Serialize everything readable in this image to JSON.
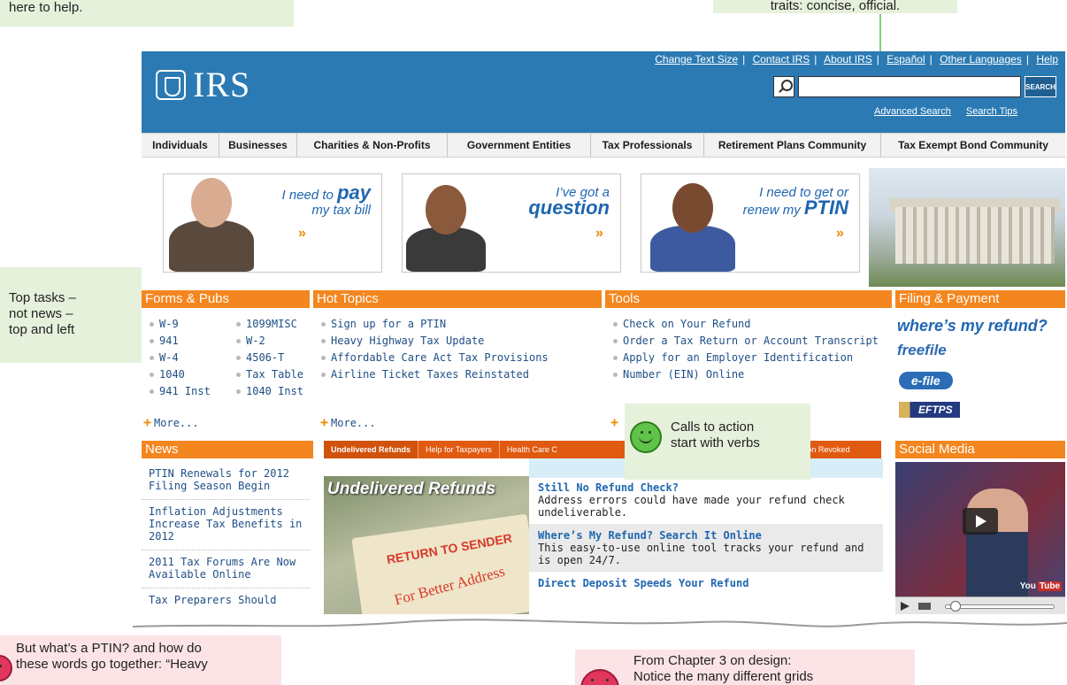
{
  "annotations": {
    "top_left": "here to help.",
    "top_right": "traits: concise, official.",
    "left": [
      "Top tasks –",
      "not news –",
      "top and left"
    ],
    "calls_to_action": [
      "Calls to action",
      "start with verbs"
    ],
    "bottom_left": [
      "But what’s a PTIN? and how do",
      "these words go together: “Heavy"
    ],
    "bottom_right": [
      "From Chapter 3 on design:",
      "Notice the many different grids"
    ]
  },
  "header": {
    "logo": "IRS",
    "top_links": [
      "Change Text Size",
      "Contact IRS",
      "About IRS",
      "Español",
      "Other Languages",
      "Help"
    ],
    "search_button": "SEARCH",
    "search_links": [
      "Advanced Search",
      "Search Tips"
    ]
  },
  "nav": [
    "Individuals",
    "Businesses",
    "Charities & Non-Profits",
    "Government Entities",
    "Tax Professionals",
    "Retirement Plans Community",
    "Tax Exempt Bond Community"
  ],
  "promos": [
    {
      "lead": "I need to",
      "big": "pay",
      "rest": "my tax bill",
      "arrow": "»"
    },
    {
      "lead": "I’ve got a",
      "big": "question",
      "rest": "",
      "arrow": "»"
    },
    {
      "lead": "I need to get or",
      "big": "PTIN",
      "rest": "renew my",
      "arrow": "»"
    }
  ],
  "forms": {
    "title": "Forms & Pubs",
    "col1": [
      "W-9",
      "941",
      "W-4",
      "1040",
      "941 Inst"
    ],
    "col2": [
      "1099MISC",
      "W-2",
      "4506-T",
      "Tax Table",
      "1040 Inst"
    ],
    "more": "More..."
  },
  "hot_topics": {
    "title": "Hot Topics",
    "items": [
      "Sign up for a PTIN",
      "Heavy Highway Tax Update",
      "Affordable Care Act Tax Provisions",
      "Airline Ticket Taxes Reinstated"
    ],
    "more": "More..."
  },
  "tools": {
    "title": "Tools",
    "items": [
      "Check on Your Refund",
      "Order a Tax Return or Account Transcript",
      "Apply for an Employer Identification",
      "Number (EIN) Online"
    ]
  },
  "filing": {
    "title": "Filing & Payment",
    "logos": [
      "where’s my refund?",
      "freefile",
      "e-file",
      "EFTPS"
    ]
  },
  "news": {
    "title": "News",
    "items": [
      "PTIN Renewals for 2012 Filing Season Begin",
      "Inflation Adjustments Increase Tax Benefits in 2012",
      "2011 Tax Forums Are Now Available Online",
      "Tax Preparers Should"
    ]
  },
  "feature_tabs": [
    "Undelivered Refunds",
    "Help for Taxpayers",
    "Health Care C",
    "otion Revoked"
  ],
  "feature": {
    "image_title": "Undelivered Refunds",
    "stamp": "RETURN TO SENDER",
    "stamp_text": "For Better Address",
    "stories": [
      {
        "title": "Still No Refund Check?",
        "body": "Address errors could have made your refund check undeliverable."
      },
      {
        "title": "Where’s My Refund? Search It Online",
        "body": "This easy-to-use online tool tracks your refund and is open 24/7."
      },
      {
        "title": "Direct Deposit Speeds Your Refund",
        "body": ""
      }
    ]
  },
  "social": {
    "title": "Social Media",
    "badge_you": "You",
    "badge_tube": "Tube"
  },
  "colors": {
    "header_blue": "#2b7ab3",
    "section_orange": "#f4861f",
    "link_blue": "#1f4f86"
  }
}
